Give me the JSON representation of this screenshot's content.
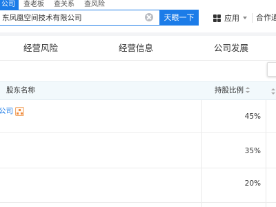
{
  "search": {
    "tabs": [
      "公司",
      "查老板",
      "查关系",
      "查风险"
    ],
    "active_tab": 0,
    "query": "东凤凰空间技术有限公司",
    "button_label": "天眼一下"
  },
  "header_right": {
    "apps_label": "应用",
    "coop_label": "合作通"
  },
  "section_nav": {
    "items": [
      "经营风险",
      "经营信息",
      "公司发展"
    ]
  },
  "table": {
    "columns": {
      "name": "股东名称",
      "ratio": "持股比例"
    },
    "rows": [
      {
        "name": "公司",
        "ratio": "45%"
      },
      {
        "name": "",
        "ratio": "35%"
      },
      {
        "name": "",
        "ratio": "20%"
      }
    ]
  },
  "colors": {
    "accent": "#1c7ce8",
    "header_bg": "#f2f9fc",
    "icon_orange": "#f08a3c"
  }
}
